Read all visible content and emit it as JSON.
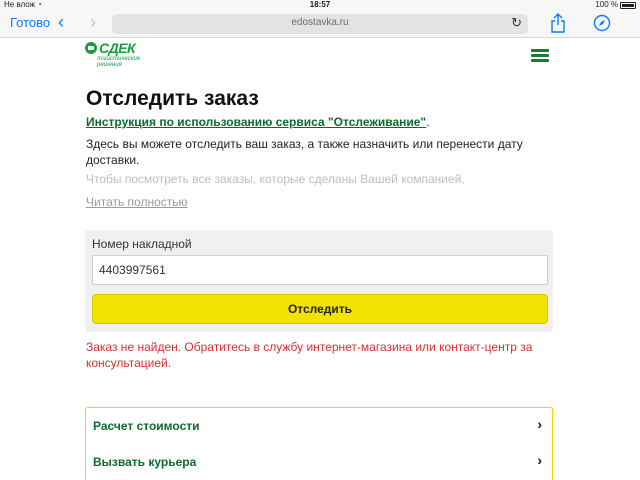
{
  "status_bar": {
    "carrier": "Не влож",
    "time": "18:57",
    "battery": "100 %"
  },
  "browser": {
    "done_label": "Готово",
    "url": "edostavka.ru",
    "icons": [
      "back-chevron",
      "forward-chevron",
      "reload",
      "share",
      "compass"
    ]
  },
  "site": {
    "logo_text": "СДЕК",
    "logo_tagline": "логистические решения",
    "brand_color": "#1b9e3e"
  },
  "page": {
    "title": "Отследить заказ",
    "instruction_link": "Инструкция по использованию сервиса \"Отслеживание\"",
    "instruction_dot": ".",
    "para1": "Здесь вы можете отследить ваш заказ, а также назначить или перенести дату доставки.",
    "para2": "Чтобы посмотреть все заказы, которые сделаны Вашей компанией,",
    "read_more": "Читать полностью"
  },
  "tracking_form": {
    "label": "Номер накладной",
    "value": "4403997561",
    "button_label": "Отследить",
    "button_color": "#f2e200"
  },
  "error": {
    "text": "Заказ не найден. Обратитесь в службу интернет-магазина или контакт-центр за консультацией.",
    "color": "#d83030"
  },
  "links": [
    {
      "label": "Расчет стоимости"
    },
    {
      "label": "Вызвать курьера"
    }
  ]
}
